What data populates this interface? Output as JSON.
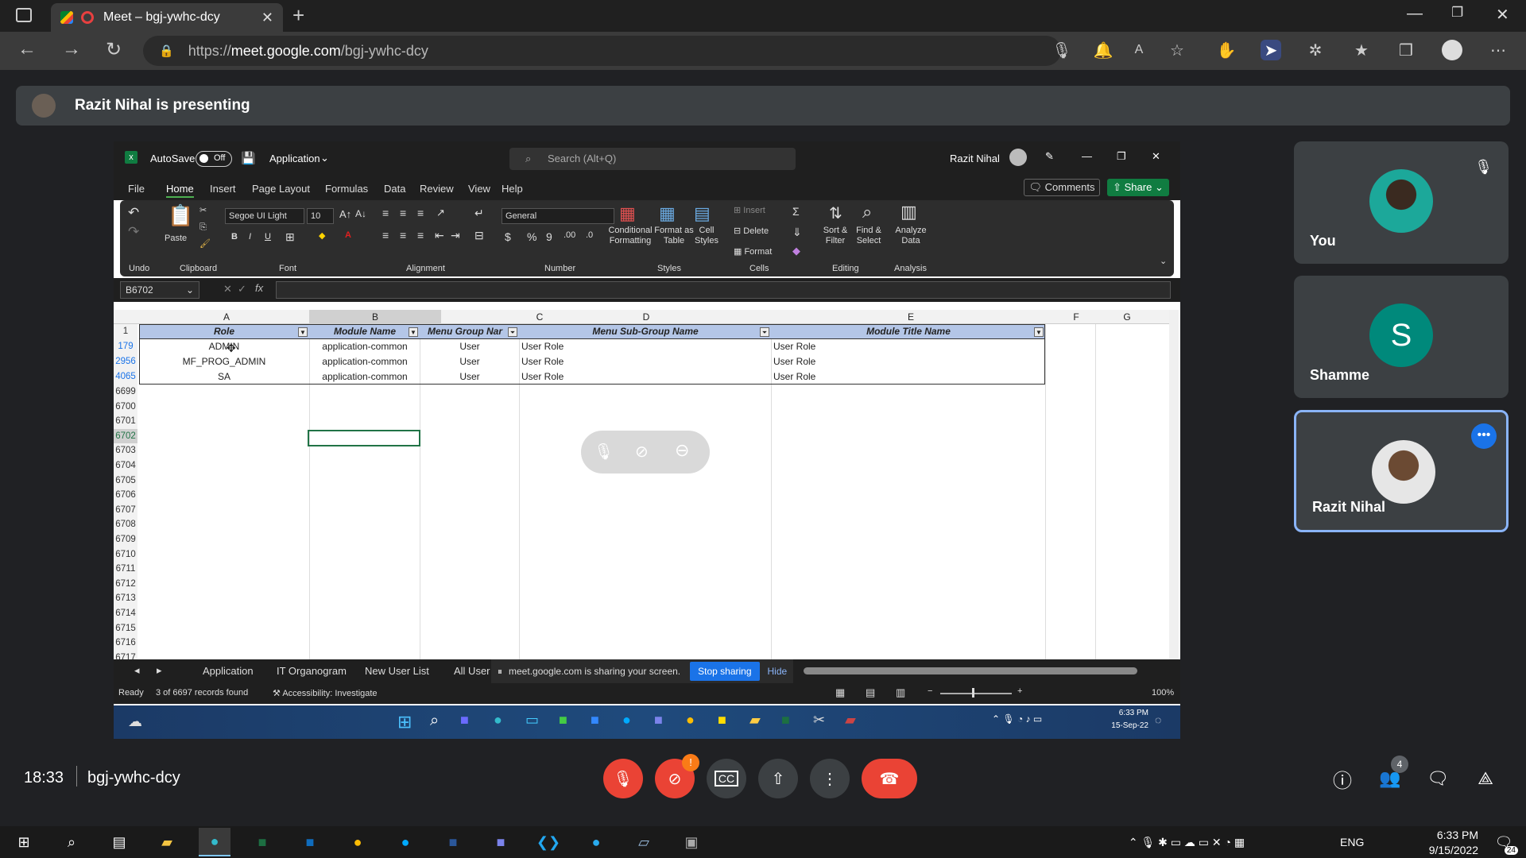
{
  "browser": {
    "tab_title": "Meet – bgj-ywhc-dcy",
    "url_prefix": "https://",
    "url_host": "meet.google.com",
    "url_path": "/bgj-ywhc-dcy"
  },
  "meet": {
    "presenting_banner": "Razit Nihal is presenting",
    "time": "18:33",
    "meeting_code": "bgj-ywhc-dcy",
    "people_count": "4",
    "participants": [
      {
        "name": "You"
      },
      {
        "name": "Shamme",
        "initial": "S",
        "color": "#00897b"
      },
      {
        "name": "Razit Nihal"
      }
    ]
  },
  "excel": {
    "autosave_label": "AutoSave",
    "autosave_state": "Off",
    "workbook": "Application",
    "search_placeholder": "Search (Alt+Q)",
    "user": "Razit Nihal",
    "menu": [
      "File",
      "Home",
      "Insert",
      "Page Layout",
      "Formulas",
      "Data",
      "Review",
      "View",
      "Help"
    ],
    "comments": "Comments",
    "share": "Share",
    "ribbon": {
      "undo": "Undo",
      "paste": "Paste",
      "clipboard": "Clipboard",
      "font_name": "Segoe UI Light",
      "font_size": "10",
      "font": "Font",
      "alignment": "Alignment",
      "number_format": "General",
      "number": "Number",
      "cond_fmt": "Conditional Formatting",
      "fmt_table": "Format as Table",
      "cell_styles": "Cell Styles",
      "styles": "Styles",
      "insert": "Insert",
      "delete": "Delete",
      "format": "Format",
      "cells": "Cells",
      "sort_filter": "Sort & Filter",
      "find_select": "Find & Select",
      "editing": "Editing",
      "analyze": "Analyze Data",
      "analysis": "Analysis"
    },
    "name_box": "B6702",
    "columns": [
      "A",
      "B",
      "C",
      "D",
      "E",
      "F",
      "G"
    ],
    "headers": [
      "Role",
      "Module Name",
      "Menu Group Nar",
      "Menu Sub-Group Name",
      "Module Title Name"
    ],
    "rows": [
      {
        "n": "179",
        "a": "ADMIN",
        "b": "application-common",
        "c": "User",
        "d": "User Role",
        "e": "User Role"
      },
      {
        "n": "2956",
        "a": "MF_PROG_ADMIN",
        "b": "application-common",
        "c": "User",
        "d": "User Role",
        "e": "User Role"
      },
      {
        "n": "4065",
        "a": "SA",
        "b": "application-common",
        "c": "User",
        "d": "User Role",
        "e": "User Role"
      }
    ],
    "empty_rows": [
      "6699",
      "6700",
      "6701",
      "6702",
      "6703",
      "6704",
      "6705",
      "6706",
      "6707",
      "6708",
      "6709",
      "6710",
      "6711",
      "6712",
      "6713",
      "6714",
      "6715",
      "6716",
      "6717"
    ],
    "sheets": [
      "Application",
      "IT Organogram",
      "New User List",
      "All User"
    ],
    "status_ready": "Ready",
    "status_records": "3 of 6697 records found",
    "status_accessibility": "Accessibility: Investigate",
    "zoom": "100%",
    "share_notice": "meet.google.com is sharing your screen.",
    "stop_sharing": "Stop sharing",
    "hide": "Hide",
    "inner_clock_time": "6:33 PM",
    "inner_clock_date": "15-Sep-22"
  },
  "taskbar": {
    "lang": "ENG",
    "time": "6:33 PM",
    "date": "9/15/2022",
    "notif": "24"
  }
}
